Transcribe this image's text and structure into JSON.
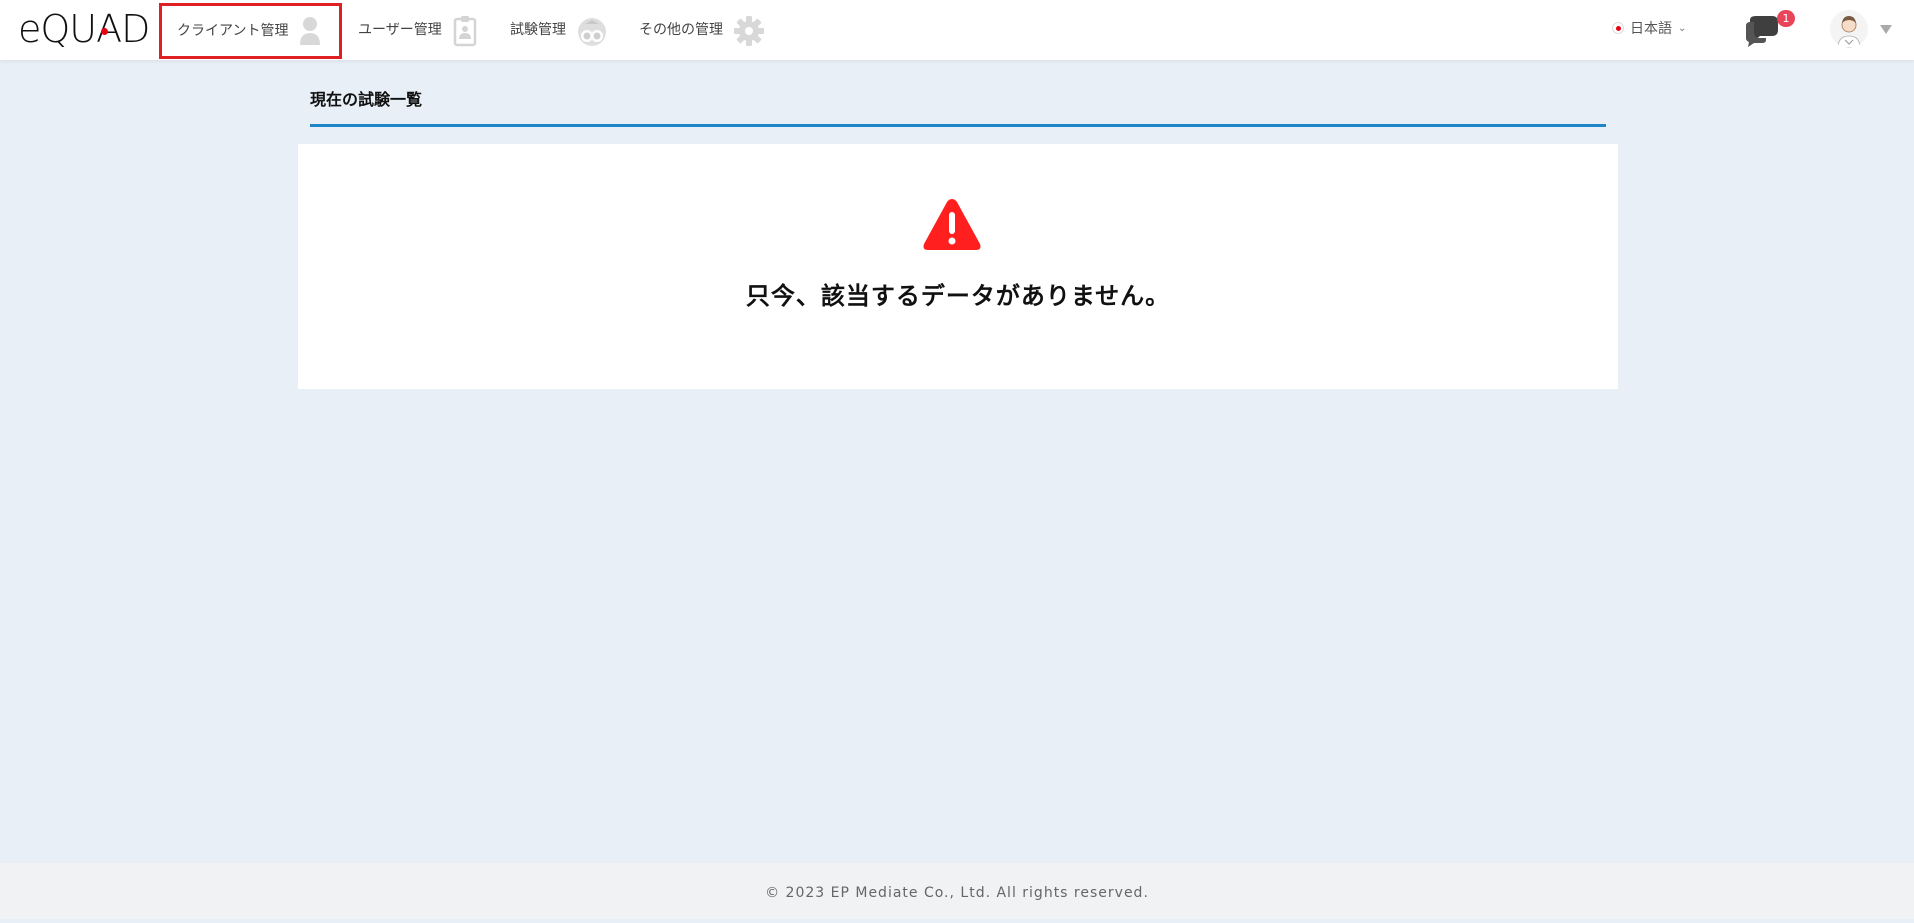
{
  "app": {
    "logo_text": "eQUAD"
  },
  "nav": {
    "items": [
      {
        "label": "クライアント管理",
        "icon": "user-icon"
      },
      {
        "label": "ユーザー管理",
        "icon": "id-badge-icon"
      },
      {
        "label": "試験管理",
        "icon": "exam-icon"
      },
      {
        "label": "その他の管理",
        "icon": "gear-icon"
      }
    ]
  },
  "header_right": {
    "language": "日本語",
    "chat_badge": "1",
    "chat_icon": "chat-bubbles-icon",
    "avatar_icon": "user-avatar-icon"
  },
  "main": {
    "section_title": "現在の試験一覧",
    "empty_message": "只今、該当するデータがありません。",
    "warning_icon": "warning-triangle-icon"
  },
  "footer": {
    "copyright": "© 2023 EP Mediate Co., Ltd. All rights reserved."
  },
  "colors": {
    "accent": "#1c86c8",
    "highlight_border": "#e01f25",
    "warning": "#ff1f1f",
    "badge": "#e8455a",
    "background": "#e8eff6"
  }
}
